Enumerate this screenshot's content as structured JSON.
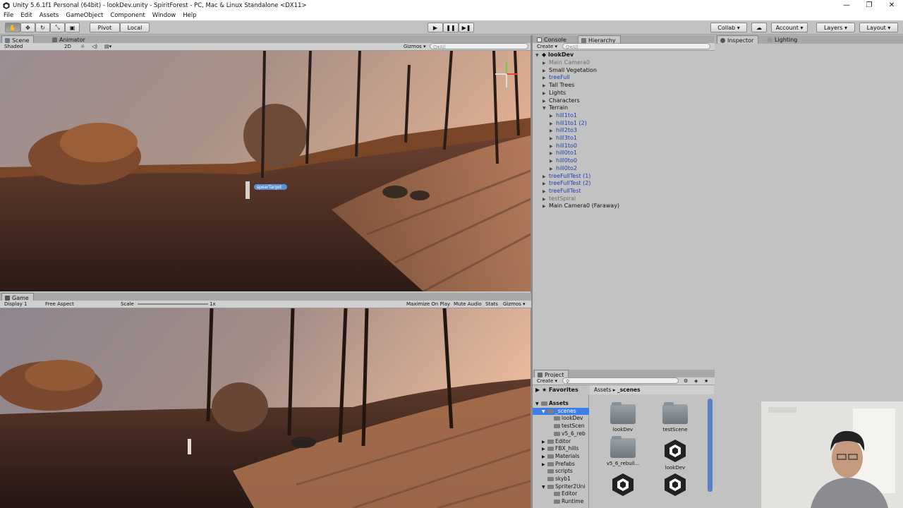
{
  "window": {
    "title": "Unity 5.6.1f1 Personal (64bit) - lookDev.unity - SpiritForest - PC, Mac & Linux Standalone <DX11>",
    "controls": [
      "—",
      "❐",
      "✕"
    ]
  },
  "menu": [
    "File",
    "Edit",
    "Assets",
    "GameObject",
    "Component",
    "Window",
    "Help"
  ],
  "toolbar": {
    "pivot": "Pivot",
    "local": "Local",
    "collab": "Collab ▾",
    "account": "Account",
    "layers": "Layers",
    "layout": "Layout"
  },
  "scene_panel": {
    "tabs": [
      "Scene",
      "Animator"
    ],
    "shading": "Shaded",
    "mode_2d": "2D",
    "gizmos": "Gizmos ▾",
    "search_placeholder": "Q▾All",
    "label": "spearTarget"
  },
  "game_panel": {
    "tab": "Game",
    "display": "Display 1",
    "aspect": "Free Aspect",
    "scale_label": "Scale",
    "scale_value": "1x",
    "buttons": [
      "Maximize On Play",
      "Mute Audio",
      "Stats",
      "Gizmos ▾"
    ]
  },
  "hierarchy": {
    "tabs": [
      "Console",
      "Hierarchy"
    ],
    "create": "Create ▾",
    "search_placeholder": "Q▾All",
    "scene": "lookDev",
    "items": [
      {
        "label": "Main Camera0",
        "style": "grey",
        "indent": 1,
        "arrow": "▶"
      },
      {
        "label": "Small Vegetation",
        "style": "",
        "indent": 1,
        "arrow": "▶"
      },
      {
        "label": "treeFull",
        "style": "prefab",
        "indent": 1,
        "arrow": "▶"
      },
      {
        "label": "Tall Trees",
        "style": "",
        "indent": 1,
        "arrow": "▶"
      },
      {
        "label": "Lights",
        "style": "",
        "indent": 1,
        "arrow": "▶"
      },
      {
        "label": "Characters",
        "style": "",
        "indent": 1,
        "arrow": "▶"
      },
      {
        "label": "Terrain",
        "style": "",
        "indent": 1,
        "arrow": "▼"
      },
      {
        "label": "hill1to1",
        "style": "prefab",
        "indent": 2,
        "arrow": "▶"
      },
      {
        "label": "hill1to1 (2)",
        "style": "prefab",
        "indent": 2,
        "arrow": "▶"
      },
      {
        "label": "hill2to3",
        "style": "prefab",
        "indent": 2,
        "arrow": "▶"
      },
      {
        "label": "hill3to1",
        "style": "prefab",
        "indent": 2,
        "arrow": "▶"
      },
      {
        "label": "hill1to0",
        "style": "prefab",
        "indent": 2,
        "arrow": "▶"
      },
      {
        "label": "hill0to1",
        "style": "prefab",
        "indent": 2,
        "arrow": "▶"
      },
      {
        "label": "hill0to0",
        "style": "prefab",
        "indent": 2,
        "arrow": "▶"
      },
      {
        "label": "hill0to2",
        "style": "prefab",
        "indent": 2,
        "arrow": "▶"
      },
      {
        "label": "treeFullTest (1)",
        "style": "prefab",
        "indent": 1,
        "arrow": "▶"
      },
      {
        "label": "treeFullTest (2)",
        "style": "prefab",
        "indent": 1,
        "arrow": "▶"
      },
      {
        "label": "treeFullTest",
        "style": "prefab",
        "indent": 1,
        "arrow": "▶"
      },
      {
        "label": "testSpiral",
        "style": "grey",
        "indent": 1,
        "arrow": "▶"
      },
      {
        "label": "Main Camera0 (Faraway)",
        "style": "",
        "indent": 1,
        "arrow": "▶"
      }
    ]
  },
  "inspector": {
    "tabs": [
      "Inspector",
      "Lighting"
    ]
  },
  "project": {
    "tab": "Project",
    "create": "Create ▾",
    "favorites": "Favorites",
    "breadcrumb_root": "Assets ▸",
    "breadcrumb_current": "_scenes",
    "tree": [
      {
        "label": "Assets",
        "indent": 0,
        "arrow": "▼",
        "bold": true
      },
      {
        "label": "_scenes",
        "indent": 1,
        "arrow": "▼",
        "selected": true
      },
      {
        "label": "lookDev",
        "indent": 2,
        "arrow": ""
      },
      {
        "label": "testScen",
        "indent": 2,
        "arrow": ""
      },
      {
        "label": "v5_6_reb",
        "indent": 2,
        "arrow": ""
      },
      {
        "label": "Editor",
        "indent": 1,
        "arrow": "▶"
      },
      {
        "label": "FBX_hills",
        "indent": 1,
        "arrow": "▶"
      },
      {
        "label": "Materials",
        "indent": 1,
        "arrow": "▶"
      },
      {
        "label": "Prefabs",
        "indent": 1,
        "arrow": "▶"
      },
      {
        "label": "scripts",
        "indent": 1,
        "arrow": ""
      },
      {
        "label": "skyb1",
        "indent": 1,
        "arrow": ""
      },
      {
        "label": "Spriter2Uni",
        "indent": 1,
        "arrow": "▼"
      },
      {
        "label": "Editor",
        "indent": 2,
        "arrow": ""
      },
      {
        "label": "Runtime",
        "indent": 2,
        "arrow": ""
      }
    ],
    "assets": [
      {
        "label": "lookDev",
        "kind": "folder"
      },
      {
        "label": "testScene",
        "kind": "folder"
      },
      {
        "label": "v5_6_rebuil...",
        "kind": "folder"
      },
      {
        "label": "lookDev",
        "kind": "unity"
      },
      {
        "label": "",
        "kind": "unity"
      },
      {
        "label": "",
        "kind": "unity"
      }
    ]
  },
  "colors": {
    "editor_bg": "#c2c2c2",
    "prefab_text": "#1f3fb0",
    "selection": "#3e7de7"
  }
}
